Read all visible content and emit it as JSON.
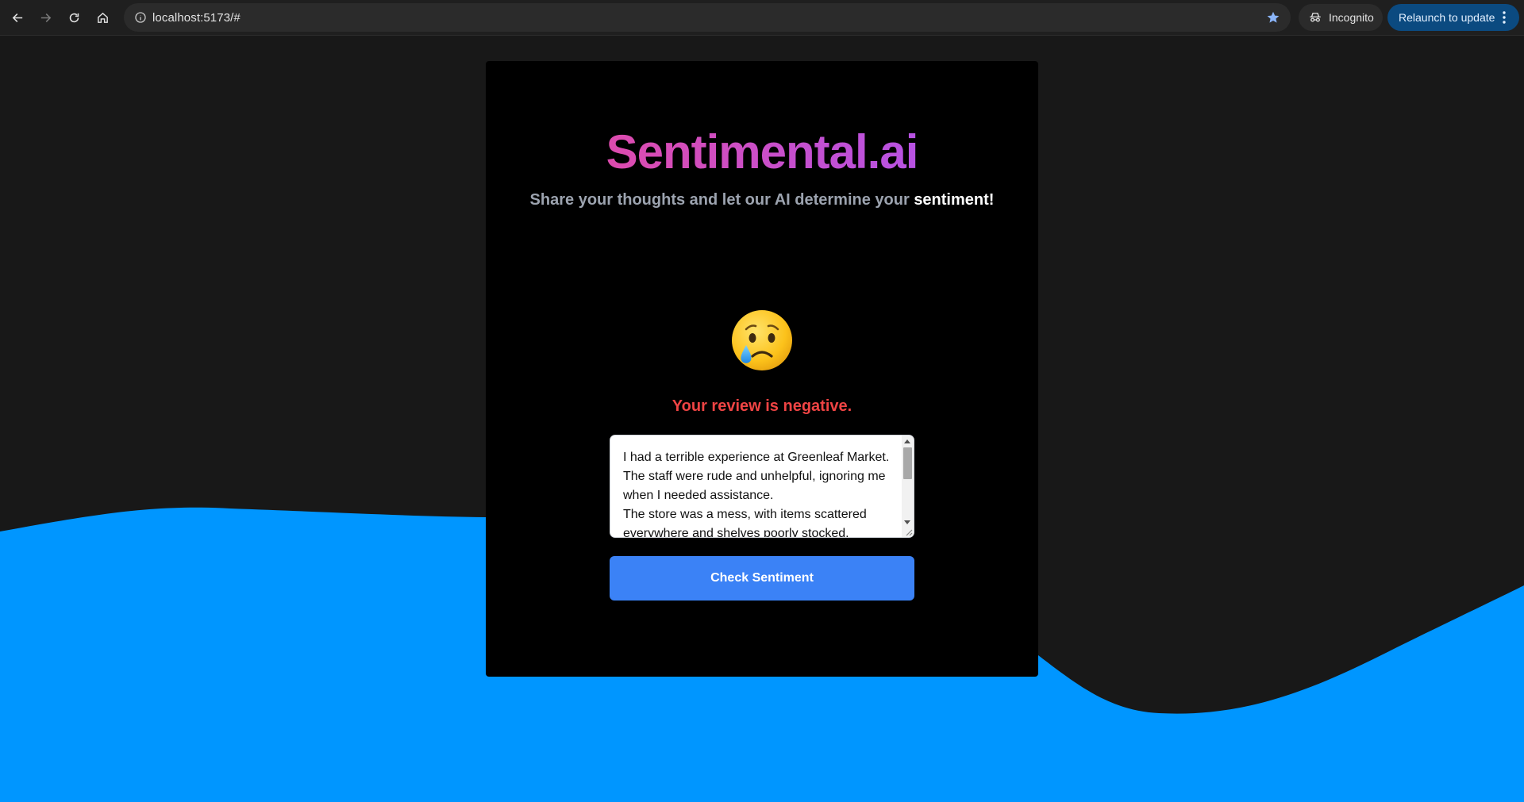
{
  "browser": {
    "url": "localhost:5173/#",
    "incognito_label": "Incognito",
    "relaunch_label": "Relaunch to update"
  },
  "app": {
    "brand": "Sentimental.ai",
    "tagline_prefix": "Share your thoughts and let our AI determine your ",
    "tagline_highlight": "sentiment!",
    "result_emoji": "crying-face",
    "result_text": "Your review is negative.",
    "review_text": "I had a terrible experience at Greenleaf Market. The staff were rude and unhelpful, ignoring me when I needed assistance.\nThe store was a mess, with items scattered everywhere and shelves poorly stocked.",
    "check_button": "Check Sentiment"
  },
  "colors": {
    "background": "#181818",
    "wave": "#0096ff",
    "card": "#000000",
    "brand_gradient_start": "#ec4899",
    "brand_gradient_end": "#a855f7",
    "negative": "#ef4444",
    "button": "#3b82f6"
  }
}
